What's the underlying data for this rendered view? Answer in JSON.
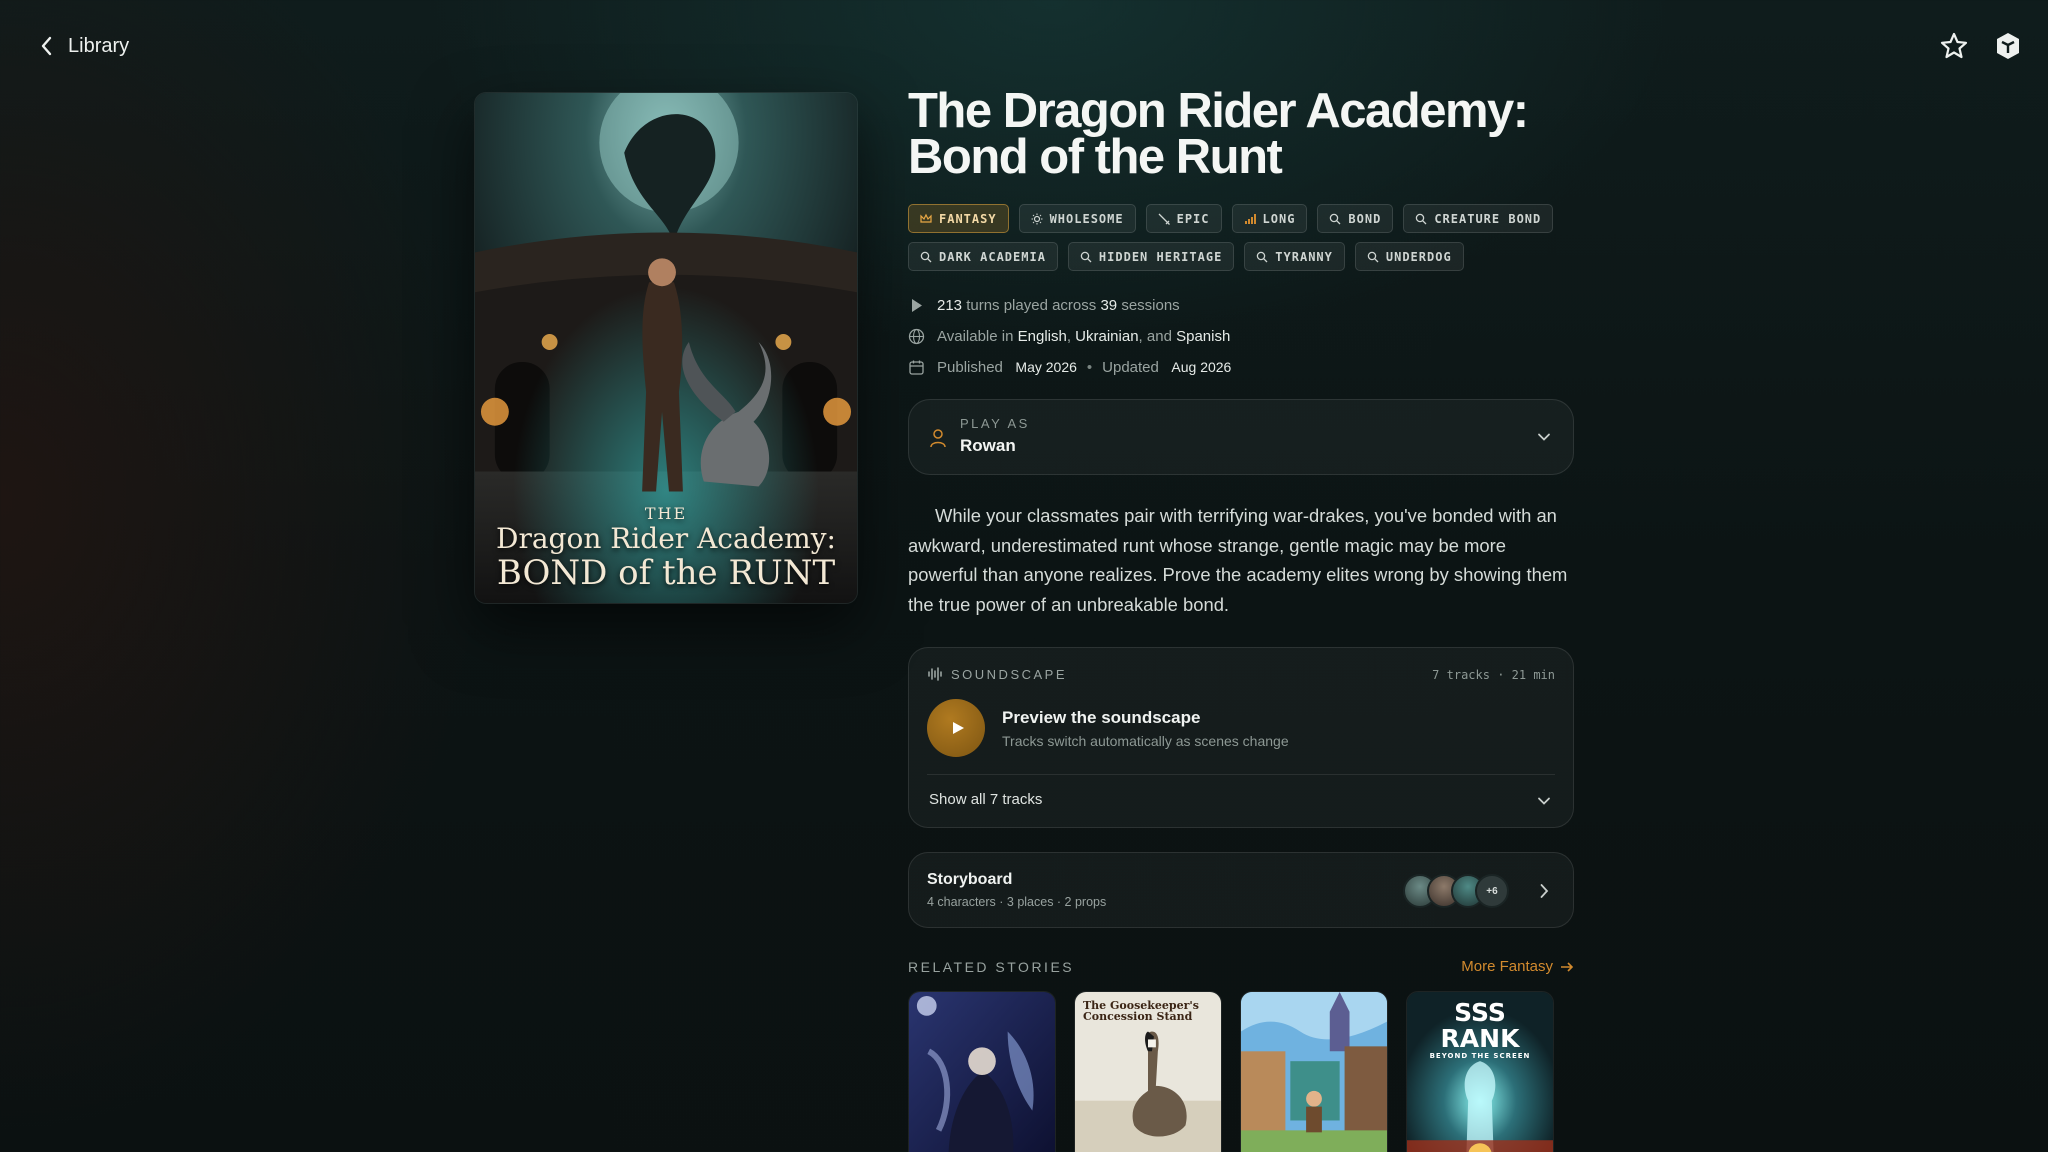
{
  "nav": {
    "back_label": "Library",
    "favorite_icon": "star-icon",
    "app_icon": "app-logo-icon"
  },
  "cover": {
    "title_small": "THE",
    "title_line1": "Dragon Rider Academy:",
    "title_line2": "BOND of the RUNT"
  },
  "story": {
    "title": "The Dragon Rider Academy: Bond of the Runt",
    "tags": [
      {
        "label": "FANTASY",
        "icon": "crown-icon",
        "primary": true
      },
      {
        "label": "WHOLESOME",
        "icon": "sun-icon"
      },
      {
        "label": "EPIC",
        "icon": "sword-icon"
      },
      {
        "label": "LONG",
        "icon": "bars-icon"
      },
      {
        "label": "BOND",
        "icon": "search-icon"
      },
      {
        "label": "CREATURE BOND",
        "icon": "search-icon"
      },
      {
        "label": "DARK ACADEMIA",
        "icon": "search-icon"
      },
      {
        "label": "HIDDEN HERITAGE",
        "icon": "search-icon"
      },
      {
        "label": "TYRANNY",
        "icon": "search-icon"
      },
      {
        "label": "UNDERDOG",
        "icon": "search-icon"
      }
    ],
    "turns": "213",
    "turns_text": "turns played across",
    "sessions": "39",
    "sessions_text": "sessions",
    "available_text": "Available in",
    "lang1": "English",
    "lang2": "Ukrainian",
    "and_text": ", and",
    "lang3": "Spanish",
    "published_label": "Published",
    "published": "May 2026",
    "updated_label": "Updated",
    "updated": "Aug 2026",
    "play_as_label": "PLAY AS",
    "play_as_value": "Rowan",
    "description": "While your classmates pair with terrifying war-drakes, you've bonded with an awkward, underestimated runt whose strange, gentle magic may be more powerful than anyone realizes. Prove the academy elites wrong by showing them the true power of an unbreakable bond."
  },
  "soundscape": {
    "label": "SOUNDSCAPE",
    "count": "7 tracks · 21 min",
    "preview_title": "Preview the soundscape",
    "preview_sub": "Tracks switch automatically as scenes change",
    "show_all": "Show all 7 tracks"
  },
  "storyboard": {
    "title": "Storyboard",
    "subtitle": "4 characters · 3 places · 2 props",
    "more_count": "+6"
  },
  "related": {
    "label": "RELATED STORIES",
    "more_link": "More Fantasy",
    "card2_title": "The Goosekeeper's Concession Stand",
    "card4_title": "SSS RANK",
    "card4_sub": "BEYOND THE SCREEN"
  },
  "colors": {
    "accent": "#d28a2e",
    "tag_primary": "#c88c28",
    "background": "#0c1414"
  }
}
